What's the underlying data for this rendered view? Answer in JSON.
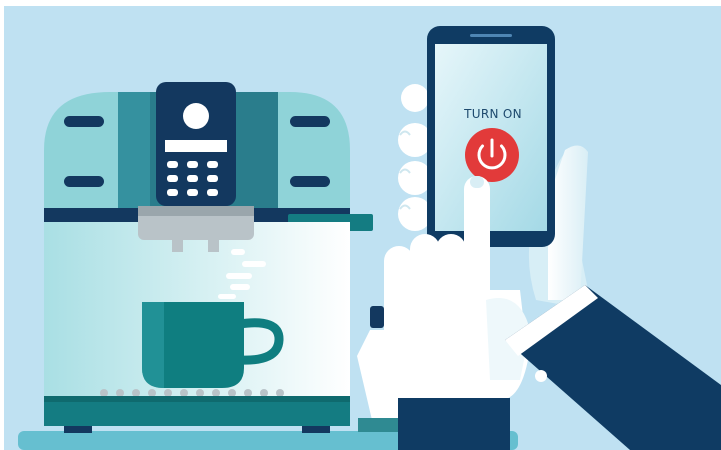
{
  "scene": "smart-coffee-machine-remote-control-illustration",
  "phone": {
    "screen_label": "TURN ON",
    "power_button_icon": "power-icon"
  },
  "colors": {
    "background": "#bfe1f2",
    "machine_body": "#8fd3d8",
    "machine_panel": "#2a7d8c",
    "control_panel": "#13385f",
    "cup": "#0f7e80",
    "phone_frame": "#0f3b63",
    "phone_screen": "#bfe6f0",
    "power_button": "#e23a3a",
    "sleeve": "#0f3b63",
    "hand": "#ffffff",
    "shadow_teal": "#2f8a92"
  }
}
